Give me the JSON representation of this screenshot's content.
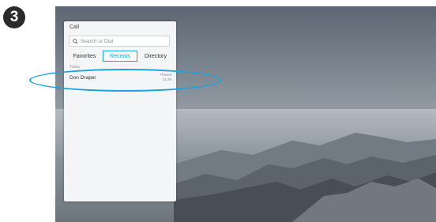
{
  "step": {
    "number": "3"
  },
  "call_panel": {
    "title": "Call",
    "search": {
      "placeholder": "Search or Dial",
      "icon": "search-icon"
    },
    "tabs": [
      {
        "label": "Favorites"
      },
      {
        "label": "Recents",
        "active": true
      },
      {
        "label": "Directory"
      }
    ],
    "group_label": "Today",
    "recents": [
      {
        "name": "Don Draper",
        "location": "Placed",
        "time": "11:28"
      }
    ]
  },
  "colors": {
    "accent": "#1aa3d9",
    "badge": "#2b2b2b",
    "panel": "#f4f5f6"
  }
}
